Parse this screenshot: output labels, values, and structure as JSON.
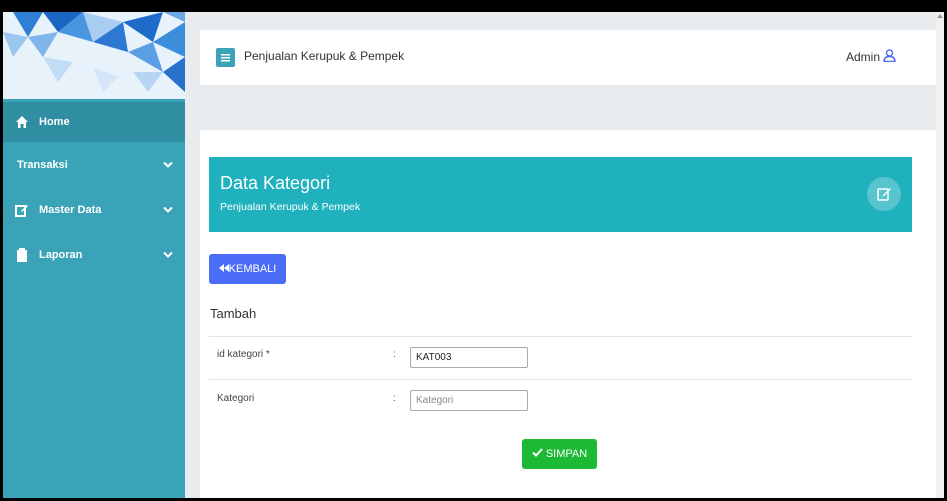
{
  "app": {
    "title": "Penjualan Kerupuk & Pempek"
  },
  "user": {
    "name": "Admin"
  },
  "sidebar": {
    "items": [
      {
        "label": "Home",
        "icon": "home-icon"
      },
      {
        "label": "Transaksi",
        "icon": "",
        "expandable": true
      },
      {
        "label": "Master Data",
        "icon": "edit-icon",
        "expandable": true
      },
      {
        "label": "Laporan",
        "icon": "clipboard-icon",
        "expandable": true
      }
    ]
  },
  "page": {
    "title": "Data Kategori",
    "subtitle": "Penjualan Kerupuk & Pempek",
    "back_label": "KEMBALI",
    "section": "Tambah",
    "fields": [
      {
        "label": "id kategori *",
        "value": "KAT003",
        "placeholder": ""
      },
      {
        "label": "Kategori",
        "value": "",
        "placeholder": "Kategori"
      }
    ],
    "save_label": "SIMPAN"
  },
  "colors": {
    "sidebar": "#3aa3b8",
    "header_banner": "#1fb1be",
    "back_button": "#4a6cf7",
    "save_button": "#1bb934"
  }
}
